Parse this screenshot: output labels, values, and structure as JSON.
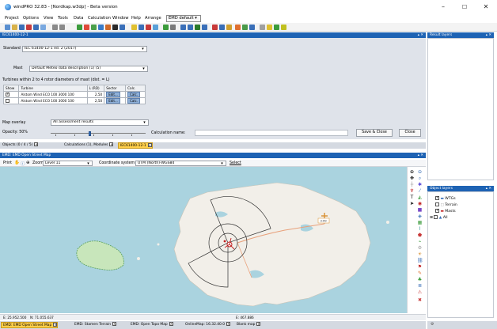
{
  "window": {
    "title": "windPRO 32.83 - [Nordkap.w3dp] - Beta version",
    "minimize": "–",
    "maximize": "☐",
    "close": "✕"
  },
  "menu": {
    "items": [
      "Project",
      "Options",
      "View",
      "Tools",
      "Data",
      "Calculation",
      "Window",
      "Help",
      "Arrange",
      "EMD default"
    ]
  },
  "std_panel": {
    "header": "IEC61400-12-1",
    "standard_label": "Standard",
    "standard_value": "IEC 61400-12-1 ed. 2 (2017)",
    "mast_label": "Mast",
    "mast_value": "Default Meteo data description (1) (5)",
    "turbines_note": "Turbines within 2 to 4 rotor diameters of mast (dist. = L)",
    "table_headers": [
      "Show",
      "Turbine",
      "L (RD)",
      "Sector",
      "Calc."
    ],
    "table_rows": [
      {
        "checked": true,
        "turbine": "Alstom Wind ECO 100 3000 100",
        "l_rd": "2,50",
        "edit": "Edit...",
        "calc": "Calc."
      },
      {
        "checked": false,
        "turbine": "Alstom Wind ECO 100 3000 100",
        "l_rd": "2,50",
        "edit": "Edit...",
        "calc": "Calc."
      }
    ],
    "map_overlay_label": "Map overlay",
    "map_overlay_value": "All assessment results",
    "opacity_label": "Opacity: 50%",
    "opacity_fraction": 0.5,
    "calc_name_label": "Calculation name:",
    "calc_name_value": "",
    "save_close": "Save & Close",
    "close": "Close"
  },
  "doc_tabs": [
    {
      "label": "Objects (0 / 4 / 5)",
      "active": false
    },
    {
      "label": "Calculations (1), Modules",
      "active": false
    },
    {
      "label": "IEC61400-12-1",
      "active": true
    }
  ],
  "map_panel": {
    "header": "EMD: EMD Open Street Map",
    "toolbar": {
      "print": "Print",
      "zoom_label": "Zoom",
      "zoom_value": "Level 11",
      "coord_label": "Coordinate system",
      "coord_value": "UTM (North)-WGS84",
      "select": "Select"
    },
    "land_color": "#f2efe9",
    "sea_color": "#aad3df",
    "park_color": "#c8e6bb",
    "road_color": "#e8a07a",
    "marker_label": "3-69"
  },
  "status": {
    "coord1": "E: 25.952.500",
    "coord2": "N: 71.055.637",
    "center": "E: 467.886"
  },
  "bottom_tabs": [
    {
      "label": "EMD: EMD Open Street Map"
    },
    {
      "label": "EMD: Stamen Terrain"
    },
    {
      "label": "EMD: Open Topo Map"
    },
    {
      "label": "OnlineMap: 16.32.40.0"
    },
    {
      "label": "Blank map"
    }
  ],
  "right_panels": {
    "result_layers": "Result layers",
    "object_layers": "Object layers",
    "tree": [
      "WTGs",
      "Terrain",
      "Masts",
      "All"
    ]
  },
  "accent": "#1e63b4"
}
